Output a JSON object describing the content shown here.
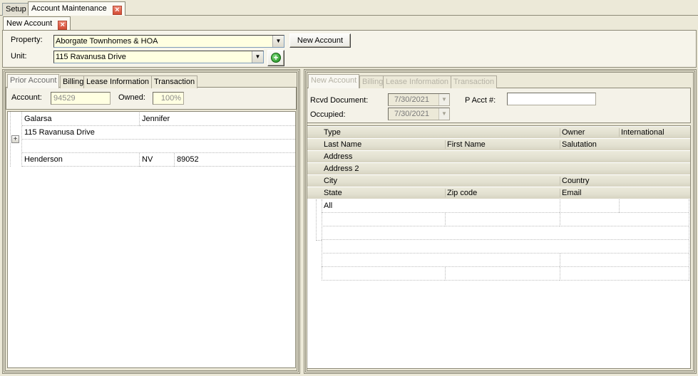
{
  "top_tabs": [
    {
      "label": "Setup",
      "active": false
    },
    {
      "label": "Account Maintenance",
      "active": true,
      "closable": true
    }
  ],
  "doc_tab": {
    "label": "New Account",
    "closable": true
  },
  "header": {
    "property_label": "Property:",
    "property_value": "Aborgate Townhomes & HOA",
    "unit_label": "Unit:",
    "unit_value": "115 Ravanusa Drive",
    "new_account_button": "New Account",
    "add_icon": "add-circle-icon"
  },
  "left_panel": {
    "tabs": [
      "Prior Account",
      "Billing",
      "Lease Information",
      "Transaction"
    ],
    "active_tab": "Prior Account",
    "account_label": "Account:",
    "account_value": "94529",
    "owned_label": "Owned:",
    "owned_value": "100%",
    "record": {
      "last_name": "Galarsa",
      "first_name": "Jennifer",
      "address": "115 Ravanusa Drive",
      "address2": "",
      "city": "Henderson",
      "state": "NV",
      "zip": "89052"
    },
    "expand_icon": "plus-expand-icon"
  },
  "right_panel": {
    "tabs": [
      "New Account",
      "Billing",
      "Lease Information",
      "Transaction"
    ],
    "active_tab": "New Account",
    "rcvd_document_label": "Rcvd Document:",
    "rcvd_document_value": "7/30/2021",
    "occupied_label": "Occupied:",
    "occupied_value": "7/30/2021",
    "p_acct_label": "P Acct #:",
    "p_acct_value": "",
    "grid_headers": {
      "row1": [
        "Type",
        "Owner",
        "International"
      ],
      "row2": [
        "Last Name",
        "First Name",
        "Salutation"
      ],
      "row3": [
        "Address"
      ],
      "row4": [
        "Address 2"
      ],
      "row5": [
        "City",
        "Country"
      ],
      "row6": [
        "State",
        "Zip code",
        "Email"
      ]
    },
    "grid_new_row": {
      "type": "All"
    }
  }
}
